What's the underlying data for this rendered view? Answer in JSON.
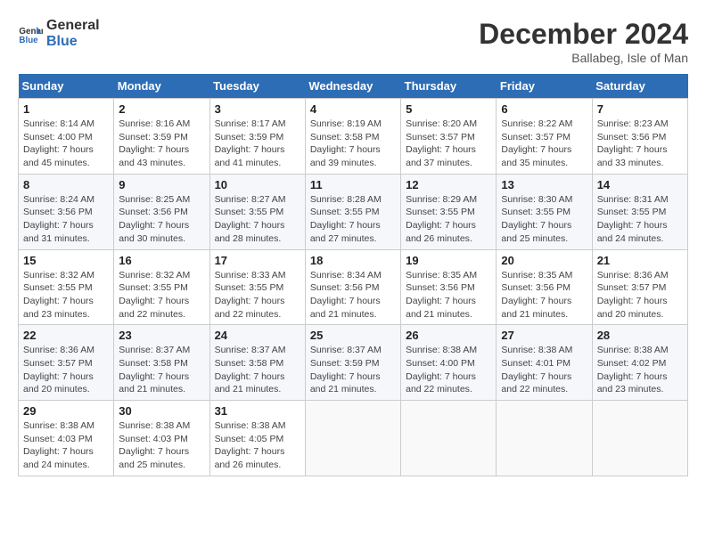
{
  "header": {
    "logo_line1": "General",
    "logo_line2": "Blue",
    "month_title": "December 2024",
    "location": "Ballabeg, Isle of Man"
  },
  "weekdays": [
    "Sunday",
    "Monday",
    "Tuesday",
    "Wednesday",
    "Thursday",
    "Friday",
    "Saturday"
  ],
  "weeks": [
    [
      {
        "day": "1",
        "info": "Sunrise: 8:14 AM\nSunset: 4:00 PM\nDaylight: 7 hours\nand 45 minutes."
      },
      {
        "day": "2",
        "info": "Sunrise: 8:16 AM\nSunset: 3:59 PM\nDaylight: 7 hours\nand 43 minutes."
      },
      {
        "day": "3",
        "info": "Sunrise: 8:17 AM\nSunset: 3:59 PM\nDaylight: 7 hours\nand 41 minutes."
      },
      {
        "day": "4",
        "info": "Sunrise: 8:19 AM\nSunset: 3:58 PM\nDaylight: 7 hours\nand 39 minutes."
      },
      {
        "day": "5",
        "info": "Sunrise: 8:20 AM\nSunset: 3:57 PM\nDaylight: 7 hours\nand 37 minutes."
      },
      {
        "day": "6",
        "info": "Sunrise: 8:22 AM\nSunset: 3:57 PM\nDaylight: 7 hours\nand 35 minutes."
      },
      {
        "day": "7",
        "info": "Sunrise: 8:23 AM\nSunset: 3:56 PM\nDaylight: 7 hours\nand 33 minutes."
      }
    ],
    [
      {
        "day": "8",
        "info": "Sunrise: 8:24 AM\nSunset: 3:56 PM\nDaylight: 7 hours\nand 31 minutes."
      },
      {
        "day": "9",
        "info": "Sunrise: 8:25 AM\nSunset: 3:56 PM\nDaylight: 7 hours\nand 30 minutes."
      },
      {
        "day": "10",
        "info": "Sunrise: 8:27 AM\nSunset: 3:55 PM\nDaylight: 7 hours\nand 28 minutes."
      },
      {
        "day": "11",
        "info": "Sunrise: 8:28 AM\nSunset: 3:55 PM\nDaylight: 7 hours\nand 27 minutes."
      },
      {
        "day": "12",
        "info": "Sunrise: 8:29 AM\nSunset: 3:55 PM\nDaylight: 7 hours\nand 26 minutes."
      },
      {
        "day": "13",
        "info": "Sunrise: 8:30 AM\nSunset: 3:55 PM\nDaylight: 7 hours\nand 25 minutes."
      },
      {
        "day": "14",
        "info": "Sunrise: 8:31 AM\nSunset: 3:55 PM\nDaylight: 7 hours\nand 24 minutes."
      }
    ],
    [
      {
        "day": "15",
        "info": "Sunrise: 8:32 AM\nSunset: 3:55 PM\nDaylight: 7 hours\nand 23 minutes."
      },
      {
        "day": "16",
        "info": "Sunrise: 8:32 AM\nSunset: 3:55 PM\nDaylight: 7 hours\nand 22 minutes."
      },
      {
        "day": "17",
        "info": "Sunrise: 8:33 AM\nSunset: 3:55 PM\nDaylight: 7 hours\nand 22 minutes."
      },
      {
        "day": "18",
        "info": "Sunrise: 8:34 AM\nSunset: 3:56 PM\nDaylight: 7 hours\nand 21 minutes."
      },
      {
        "day": "19",
        "info": "Sunrise: 8:35 AM\nSunset: 3:56 PM\nDaylight: 7 hours\nand 21 minutes."
      },
      {
        "day": "20",
        "info": "Sunrise: 8:35 AM\nSunset: 3:56 PM\nDaylight: 7 hours\nand 21 minutes."
      },
      {
        "day": "21",
        "info": "Sunrise: 8:36 AM\nSunset: 3:57 PM\nDaylight: 7 hours\nand 20 minutes."
      }
    ],
    [
      {
        "day": "22",
        "info": "Sunrise: 8:36 AM\nSunset: 3:57 PM\nDaylight: 7 hours\nand 20 minutes."
      },
      {
        "day": "23",
        "info": "Sunrise: 8:37 AM\nSunset: 3:58 PM\nDaylight: 7 hours\nand 21 minutes."
      },
      {
        "day": "24",
        "info": "Sunrise: 8:37 AM\nSunset: 3:58 PM\nDaylight: 7 hours\nand 21 minutes."
      },
      {
        "day": "25",
        "info": "Sunrise: 8:37 AM\nSunset: 3:59 PM\nDaylight: 7 hours\nand 21 minutes."
      },
      {
        "day": "26",
        "info": "Sunrise: 8:38 AM\nSunset: 4:00 PM\nDaylight: 7 hours\nand 22 minutes."
      },
      {
        "day": "27",
        "info": "Sunrise: 8:38 AM\nSunset: 4:01 PM\nDaylight: 7 hours\nand 22 minutes."
      },
      {
        "day": "28",
        "info": "Sunrise: 8:38 AM\nSunset: 4:02 PM\nDaylight: 7 hours\nand 23 minutes."
      }
    ],
    [
      {
        "day": "29",
        "info": "Sunrise: 8:38 AM\nSunset: 4:03 PM\nDaylight: 7 hours\nand 24 minutes."
      },
      {
        "day": "30",
        "info": "Sunrise: 8:38 AM\nSunset: 4:03 PM\nDaylight: 7 hours\nand 25 minutes."
      },
      {
        "day": "31",
        "info": "Sunrise: 8:38 AM\nSunset: 4:05 PM\nDaylight: 7 hours\nand 26 minutes."
      },
      {
        "day": "",
        "info": ""
      },
      {
        "day": "",
        "info": ""
      },
      {
        "day": "",
        "info": ""
      },
      {
        "day": "",
        "info": ""
      }
    ]
  ]
}
